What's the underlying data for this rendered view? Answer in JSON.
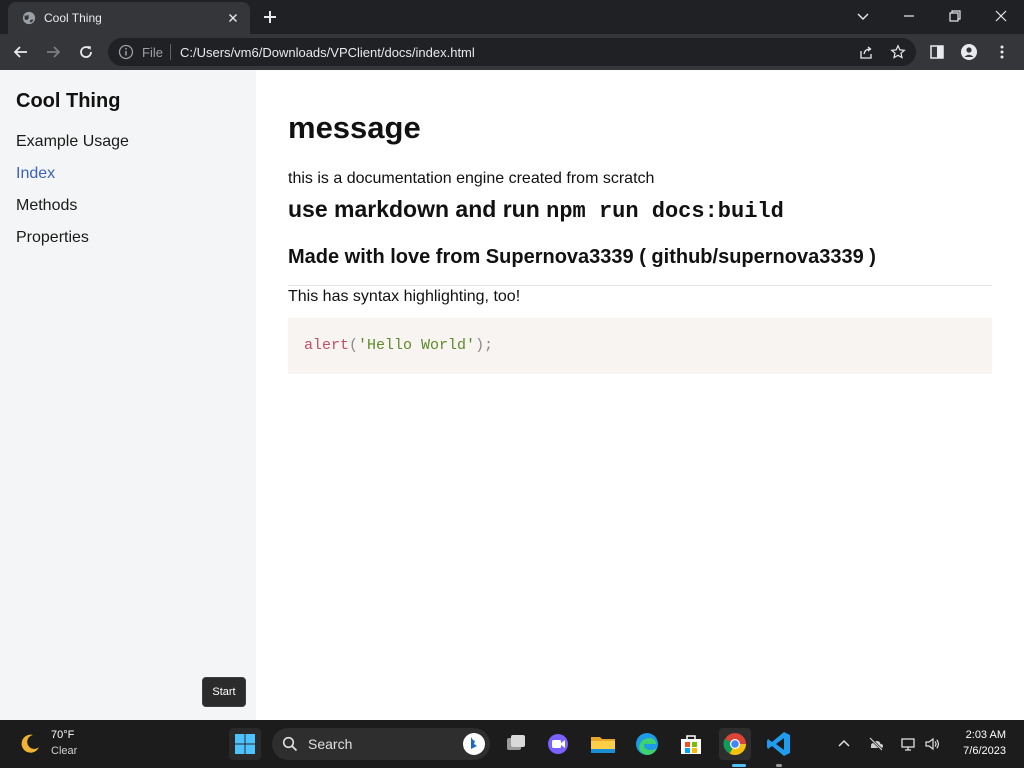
{
  "browser": {
    "tab_title": "Cool Thing",
    "omnibox_scheme_label": "File",
    "url": "C:/Users/vm6/Downloads/VPClient/docs/index.html"
  },
  "sidebar": {
    "site_title": "Cool Thing",
    "nav": [
      {
        "label": "Example Usage",
        "active": false
      },
      {
        "label": "Index",
        "active": true
      },
      {
        "label": "Methods",
        "active": false
      },
      {
        "label": "Properties",
        "active": false
      }
    ]
  },
  "content": {
    "title": "message",
    "intro": "this is a documentation engine created from scratch",
    "h2_text": "use markdown and run ",
    "h2_code": "npm run docs:build",
    "h3": "Made with love from Supernova3339 ( github/supernova3339 )",
    "syntax_note": "This has syntax highlighting, too!",
    "code": {
      "fn": "alert",
      "open": "(",
      "string": "'Hello World'",
      "close": ");"
    }
  },
  "tooltip": {
    "label": "Start"
  },
  "taskbar": {
    "weather_temp": "70°F",
    "weather_condition": "Clear",
    "search_label": "Search",
    "clock_time": "2:03 AM",
    "clock_date": "7/6/2023"
  },
  "colors": {
    "accent_link": "#3b62b8",
    "code_function": "#c44d6e",
    "code_string": "#5d8a2a",
    "sidebar_bg": "#f4f5f6",
    "code_bg": "#f7f4f1"
  }
}
